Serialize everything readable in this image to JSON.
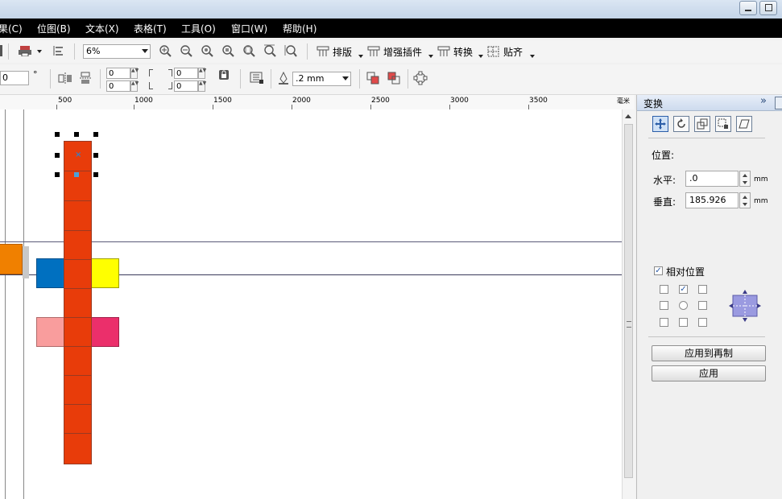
{
  "menubar": {
    "items": [
      "果(C)",
      "位图(B)",
      "文本(X)",
      "表格(T)",
      "工具(O)",
      "窗口(W)",
      "帮助(H)"
    ]
  },
  "toolbar1": {
    "zoom_value": "6%",
    "buttons": [
      "排版",
      "增强插件",
      "转换",
      "贴齐"
    ]
  },
  "toolbar2": {
    "angle_value": "0",
    "angle_unit": "°",
    "dup_x": "0",
    "dup_y": "0",
    "nudge_x": "0",
    "nudge_y": "0",
    "outline_width": ".2 mm"
  },
  "ruler": {
    "labels": [
      "500",
      "1000",
      "1500",
      "2000",
      "2500",
      "3000",
      "3500"
    ],
    "unit": "毫米"
  },
  "docker": {
    "title": "变换",
    "position_heading": "位置:",
    "h_label": "水平:",
    "h_value": ".0",
    "v_label": "垂直:",
    "v_value": "185.926",
    "unit": "mm",
    "relative_label": "相对位置",
    "relative_checked": true,
    "anchor_selected": "top-center",
    "apply_to_duplicate": "应用到再制",
    "apply": "应用"
  },
  "colors": {
    "red": "#e83c0a",
    "blue": "#0070c0",
    "yellow": "#ffff00",
    "pink": "#f99d9d",
    "magenta": "#eb2f6b",
    "orange": "#f08000",
    "guide": "#3a3a5a"
  },
  "icons": {
    "mode_buttons": [
      "position-icon",
      "rotate-icon",
      "scale-icon",
      "size-icon",
      "skew-icon"
    ]
  }
}
